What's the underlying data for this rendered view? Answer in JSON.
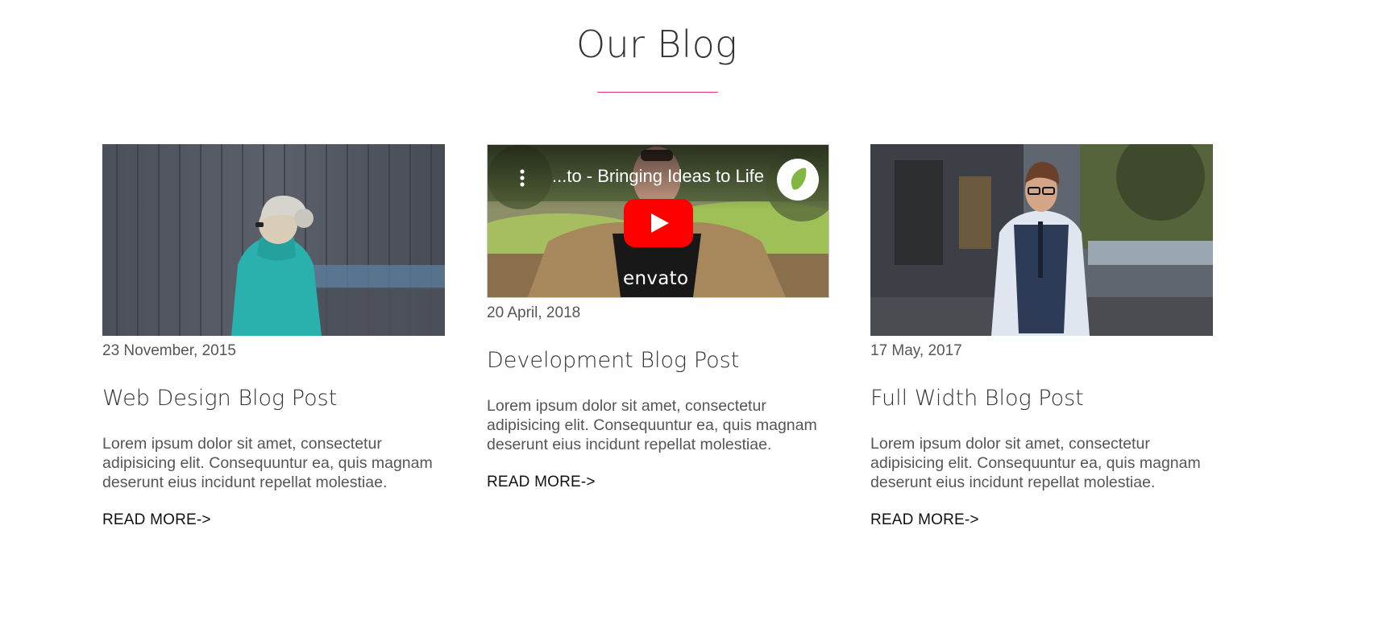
{
  "section": {
    "title": "Our Blog",
    "accent_color": "#e53d5c"
  },
  "posts": [
    {
      "image": "person-in-teal-jacket-photo",
      "date": "23 November, 2015",
      "title": "Web Design Blog Post",
      "excerpt": "Lorem ipsum dolor sit amet, consectetur adipisicing elit. Consequuntur ea, quis magnam deserunt eius incidunt repellat molestiae.",
      "read_more": "READ MORE->"
    },
    {
      "video": {
        "title": "...to - Bringing Ideas to Life",
        "overlay_text": "envato",
        "icons": [
          "more-vert-icon",
          "youtube-play-icon",
          "envato-leaf-icon"
        ]
      },
      "date": "20 April, 2018",
      "title": "Development Blog Post",
      "excerpt": "Lorem ipsum dolor sit amet, consectetur adipisicing elit. Consequuntur ea, quis magnam deserunt eius incidunt repellat molestiae.",
      "read_more": "READ MORE->"
    },
    {
      "image": "man-in-vest-street-photo",
      "date": "17 May, 2017",
      "title": "Full Width Blog Post",
      "excerpt": "Lorem ipsum dolor sit amet, consectetur adipisicing elit. Consequuntur ea, quis magnam deserunt eius incidunt repellat molestiae.",
      "read_more": "READ MORE->"
    }
  ]
}
